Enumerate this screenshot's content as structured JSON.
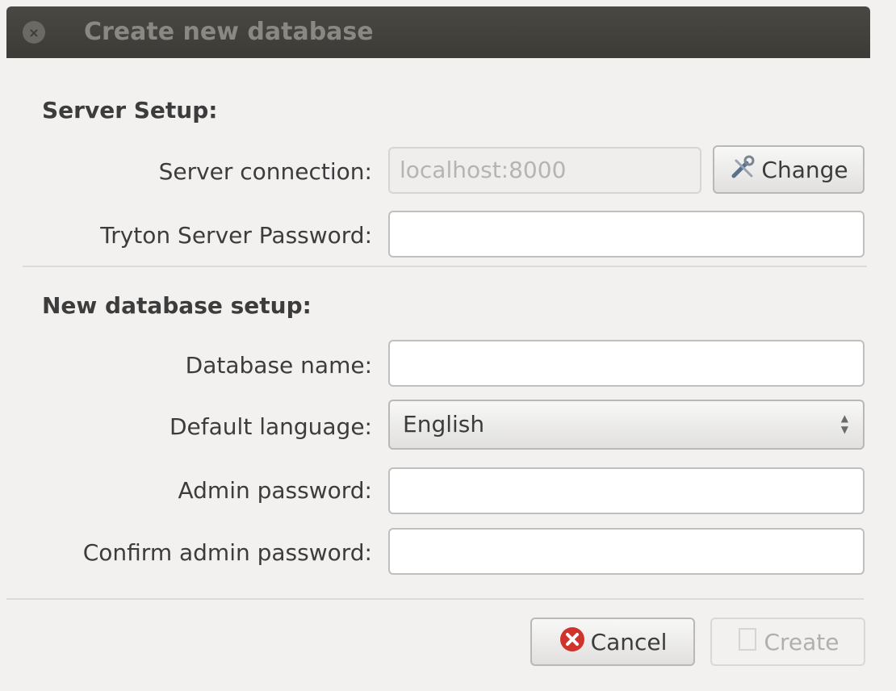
{
  "window": {
    "title": "Create new database"
  },
  "server_setup": {
    "heading": "Server Setup:",
    "connection_label": "Server connection:",
    "connection_value": "localhost:8000",
    "change_label": "Change",
    "password_label": "Tryton Server Password:",
    "password_value": ""
  },
  "new_db": {
    "heading": "New database setup:",
    "name_label": "Database name:",
    "name_value": "",
    "language_label": "Default language:",
    "language_value": "English",
    "admin_pw_label": "Admin password:",
    "admin_pw_value": "",
    "confirm_pw_label": "Confirm admin password:",
    "confirm_pw_value": ""
  },
  "buttons": {
    "cancel": "Cancel",
    "create": "Create"
  },
  "colors": {
    "titlebar": "#3d3b37",
    "cancel_icon": "#d0332b"
  }
}
